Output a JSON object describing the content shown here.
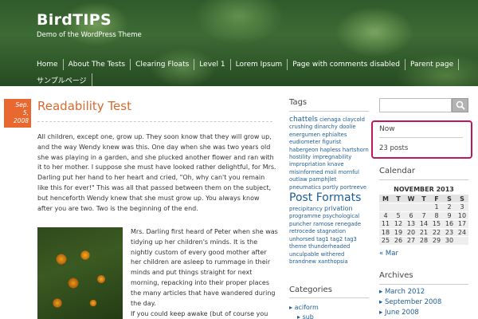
{
  "site": {
    "title": "BirdTIPS",
    "description": "Demo of the WordPress Theme"
  },
  "nav": [
    "Home",
    "About The Tests",
    "Clearing Floats",
    "Level 1",
    "Lorem Ipsum",
    "Page with comments disabled",
    "Parent page",
    "サンプルページ"
  ],
  "post": {
    "date_line1": "Sep.",
    "date_line2": "5,",
    "date_line3": "2008",
    "title": "Readability Test",
    "paragraph1": "All children, except one, grow up. They soon know that they will grow up, and the way Wendy knew was this. One day when she was two years old she was playing in a garden, and she plucked another flower and ran with it to her mother. I suppose she must have looked rather delightful, for Mrs. Darling put her hand to her heart and cried, \"Oh, why can't you remain like this for ever!\" This was all that passed between them on the subject, but henceforth Wendy knew that she must grow up. You always know after you are two. Two is the beginning of the end.",
    "paragraph2": "Mrs. Darling first heard of Peter when she was tidying up her children's minds. It is the nightly custom of every good mother after her children are asleep to rummage in their minds and put things straight for next morning, repacking into their proper places the many articles that have wandered during the day.",
    "paragraph3": "If you could keep awake (but of course you"
  },
  "tags_widget": {
    "title": "Tags",
    "tags": [
      {
        "label": "chattels",
        "size": "big"
      },
      {
        "label": "cienaga",
        "size": "small"
      },
      {
        "label": "claycold",
        "size": "small"
      },
      {
        "label": "crushing",
        "size": "small"
      },
      {
        "label": "dinarchy",
        "size": "small"
      },
      {
        "label": "doolie",
        "size": "small"
      },
      {
        "label": "energumen",
        "size": "small"
      },
      {
        "label": "ephialtes",
        "size": "small"
      },
      {
        "label": "eudiometer",
        "size": "small"
      },
      {
        "label": "figurist",
        "size": "small"
      },
      {
        "label": "habergeon",
        "size": "small"
      },
      {
        "label": "hapless",
        "size": "small"
      },
      {
        "label": "hartshorn",
        "size": "small"
      },
      {
        "label": "hostility",
        "size": "small"
      },
      {
        "label": "impregnability",
        "size": "small"
      },
      {
        "label": "impropriation",
        "size": "small"
      },
      {
        "label": "knave",
        "size": "small"
      },
      {
        "label": "misinformed",
        "size": "small"
      },
      {
        "label": "moil",
        "size": "small"
      },
      {
        "label": "mornful",
        "size": "small"
      },
      {
        "label": "outlaw",
        "size": "small"
      },
      {
        "label": "pamphjlet",
        "size": "small"
      },
      {
        "label": "pneumatics",
        "size": "small"
      },
      {
        "label": "portly",
        "size": "small"
      },
      {
        "label": "portreeve",
        "size": "small"
      },
      {
        "label": "Post Formats",
        "size": "huge"
      },
      {
        "label": "precipitancy",
        "size": "small"
      },
      {
        "label": "privation",
        "size": "mid"
      },
      {
        "label": "programme",
        "size": "small"
      },
      {
        "label": "psychological",
        "size": "small"
      },
      {
        "label": "puncher",
        "size": "small"
      },
      {
        "label": "ramose",
        "size": "small"
      },
      {
        "label": "renegade",
        "size": "small"
      },
      {
        "label": "retrocede",
        "size": "small"
      },
      {
        "label": "stagnation",
        "size": "small"
      },
      {
        "label": "unhorsed",
        "size": "small"
      },
      {
        "label": "tag1",
        "size": "small"
      },
      {
        "label": "tag2",
        "size": "small"
      },
      {
        "label": "tag3",
        "size": "small"
      },
      {
        "label": "theme",
        "size": "small"
      },
      {
        "label": "thunderheaded",
        "size": "small"
      },
      {
        "label": "unculpable",
        "size": "small"
      },
      {
        "label": "withered",
        "size": "small"
      },
      {
        "label": "brandnew",
        "size": "small"
      },
      {
        "label": "xanthopsia",
        "size": "small"
      }
    ]
  },
  "categories_widget": {
    "title": "Categories",
    "items": [
      "aciform",
      "sub"
    ]
  },
  "search": {
    "placeholder": ""
  },
  "now_widget": {
    "title": "Now",
    "posts": "23 posts"
  },
  "calendar": {
    "title": "Calendar",
    "caption": "NOVEMBER 2013",
    "weekdays": [
      "M",
      "T",
      "W",
      "T",
      "F",
      "S",
      "S"
    ],
    "rows": [
      [
        "",
        "",
        "",
        "",
        "1",
        "2",
        "3"
      ],
      [
        "4",
        "5",
        "6",
        "7",
        "8",
        "9",
        "10"
      ],
      [
        "11",
        "12",
        "13",
        "14",
        "15",
        "16",
        "17"
      ],
      [
        "18",
        "19",
        "20",
        "21",
        "22",
        "23",
        "24"
      ],
      [
        "25",
        "26",
        "27",
        "28",
        "29",
        "30",
        ""
      ]
    ],
    "prev": "« Mar"
  },
  "archives": {
    "title": "Archives",
    "items": [
      "March 2012",
      "September 2008",
      "June 2008"
    ]
  }
}
